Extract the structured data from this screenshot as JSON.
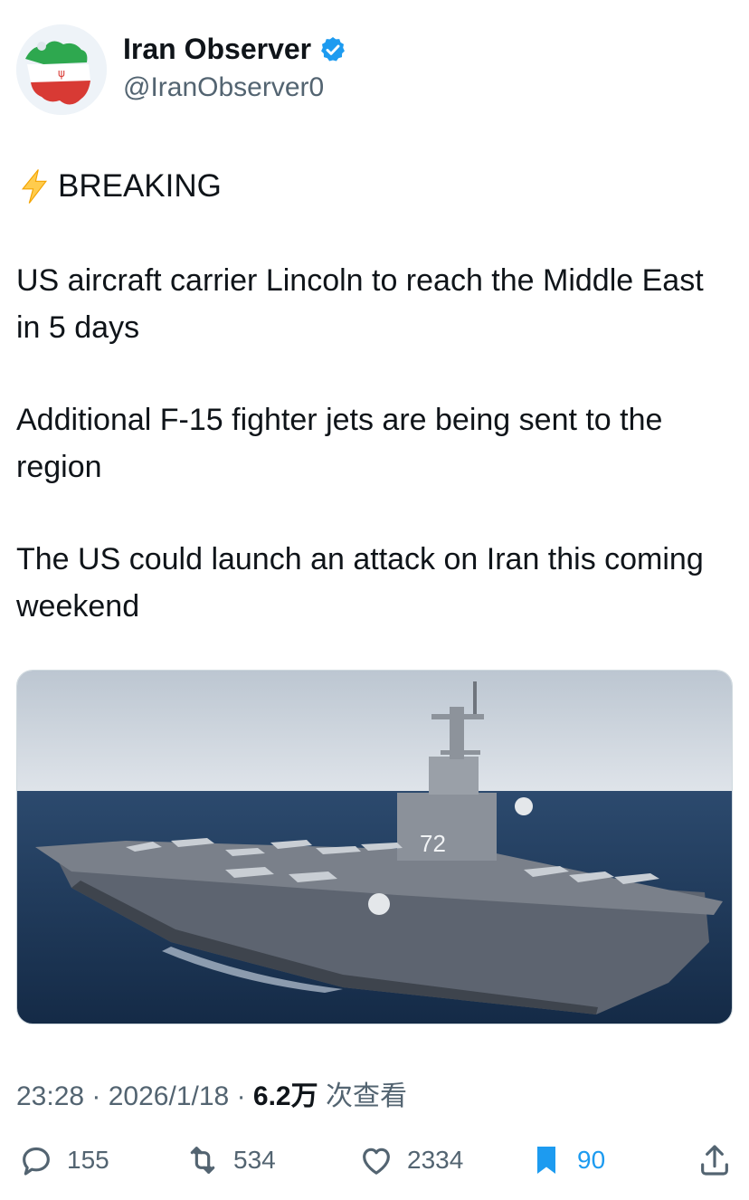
{
  "author": {
    "name": "Iran Observer",
    "handle": "@IranObserver0"
  },
  "post": {
    "breaking": "BREAKING",
    "paragraph1": "US aircraft carrier Lincoln to reach the Middle East in 5 days",
    "paragraph2": "Additional F-15 fighter jets are being sent to the region",
    "paragraph3": "The US could launch an attack on Iran this coming weekend"
  },
  "meta": {
    "time": "23:28",
    "date": "2026/1/18",
    "views": "6.2万",
    "views_label": "次查看"
  },
  "actions": {
    "replies": "155",
    "reposts": "534",
    "likes": "2334",
    "bookmarks": "90"
  },
  "colors": {
    "accent": "#1d9bf0",
    "secondary_text": "#536471",
    "bookmark_active": "#1d9bf0"
  }
}
